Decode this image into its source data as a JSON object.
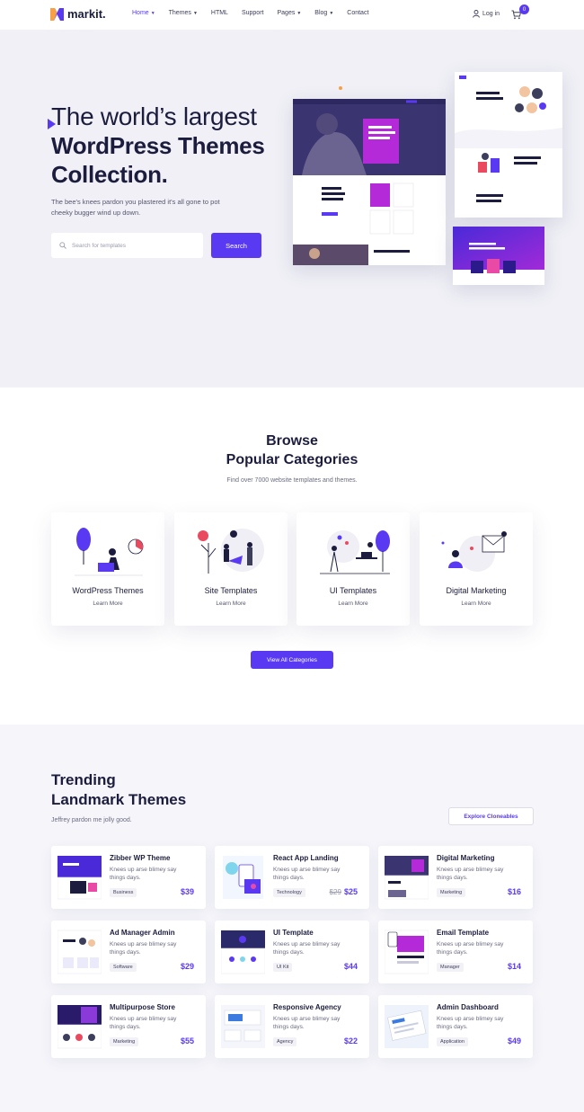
{
  "nav": {
    "brand": "markit.",
    "items": [
      {
        "label": "Home",
        "dropdown": true,
        "active": true
      },
      {
        "label": "Themes",
        "dropdown": true,
        "active": false
      },
      {
        "label": "HTML",
        "dropdown": false,
        "active": false
      },
      {
        "label": "Support",
        "dropdown": false,
        "active": false
      },
      {
        "label": "Pages",
        "dropdown": true,
        "active": false
      },
      {
        "label": "Blog",
        "dropdown": true,
        "active": false
      },
      {
        "label": "Contact",
        "dropdown": false,
        "active": false
      }
    ],
    "login_label": "Log in",
    "cart_count": "0"
  },
  "hero": {
    "title_line1": "The world’s largest",
    "title_line2": "WordPress Themes",
    "title_line3": "Collection.",
    "subtitle": "The bee's knees pardon you plastered it's all gone to pot cheeky bugger wind up down.",
    "search_placeholder": "Search for templates",
    "search_button": "Search"
  },
  "categories": {
    "title_line1": "Browse",
    "title_line2": "Popular Categories",
    "subtitle": "Find over 7000 website templates and themes.",
    "items": [
      {
        "name": "WordPress Themes",
        "link": "Learn More"
      },
      {
        "name": "Site Templates",
        "link": "Learn More"
      },
      {
        "name": "UI Templates",
        "link": "Learn More"
      },
      {
        "name": "Digital Marketing",
        "link": "Learn More"
      }
    ],
    "view_all": "View All Categories"
  },
  "trending": {
    "title_line1": "Trending",
    "title_line2": "Landmark Themes",
    "subtitle": "Jeffrey pardon me jolly good.",
    "explore": "Explore Cloneables",
    "products": [
      {
        "name": "Zibber WP Theme",
        "desc": "Knees up arse blimey say things days.",
        "tag": "Business",
        "price": "$39",
        "old_price": ""
      },
      {
        "name": "React App Landing",
        "desc": "Knees up arse blimey say things days.",
        "tag": "Technology",
        "price": "$25",
        "old_price": "$29"
      },
      {
        "name": "Digital Marketing",
        "desc": "Knees up arse blimey say things days.",
        "tag": "Marketing",
        "price": "$16",
        "old_price": ""
      },
      {
        "name": "Ad Manager Admin",
        "desc": "Knees up arse blimey say things days.",
        "tag": "Software",
        "price": "$29",
        "old_price": ""
      },
      {
        "name": "UI Template",
        "desc": "Knees up arse blimey say things days.",
        "tag": "UI Kit",
        "price": "$44",
        "old_price": ""
      },
      {
        "name": "Email Template",
        "desc": "Knees up arse blimey say things days.",
        "tag": "Manager",
        "price": "$14",
        "old_price": ""
      },
      {
        "name": "Multipurpose Store",
        "desc": "Knees up arse blimey say things days.",
        "tag": "Marketing",
        "price": "$55",
        "old_price": ""
      },
      {
        "name": "Responsive Agency",
        "desc": "Knees up arse blimey say things days.",
        "tag": "Agency",
        "price": "$22",
        "old_price": ""
      },
      {
        "name": "Admin Dashboard",
        "desc": "Knees up arse blimey say things days.",
        "tag": "Application",
        "price": "$49",
        "old_price": ""
      }
    ]
  },
  "colors": {
    "accent": "#5a39f2",
    "dark": "#1c1d3e",
    "hero_bg": "#f0f0f6"
  }
}
